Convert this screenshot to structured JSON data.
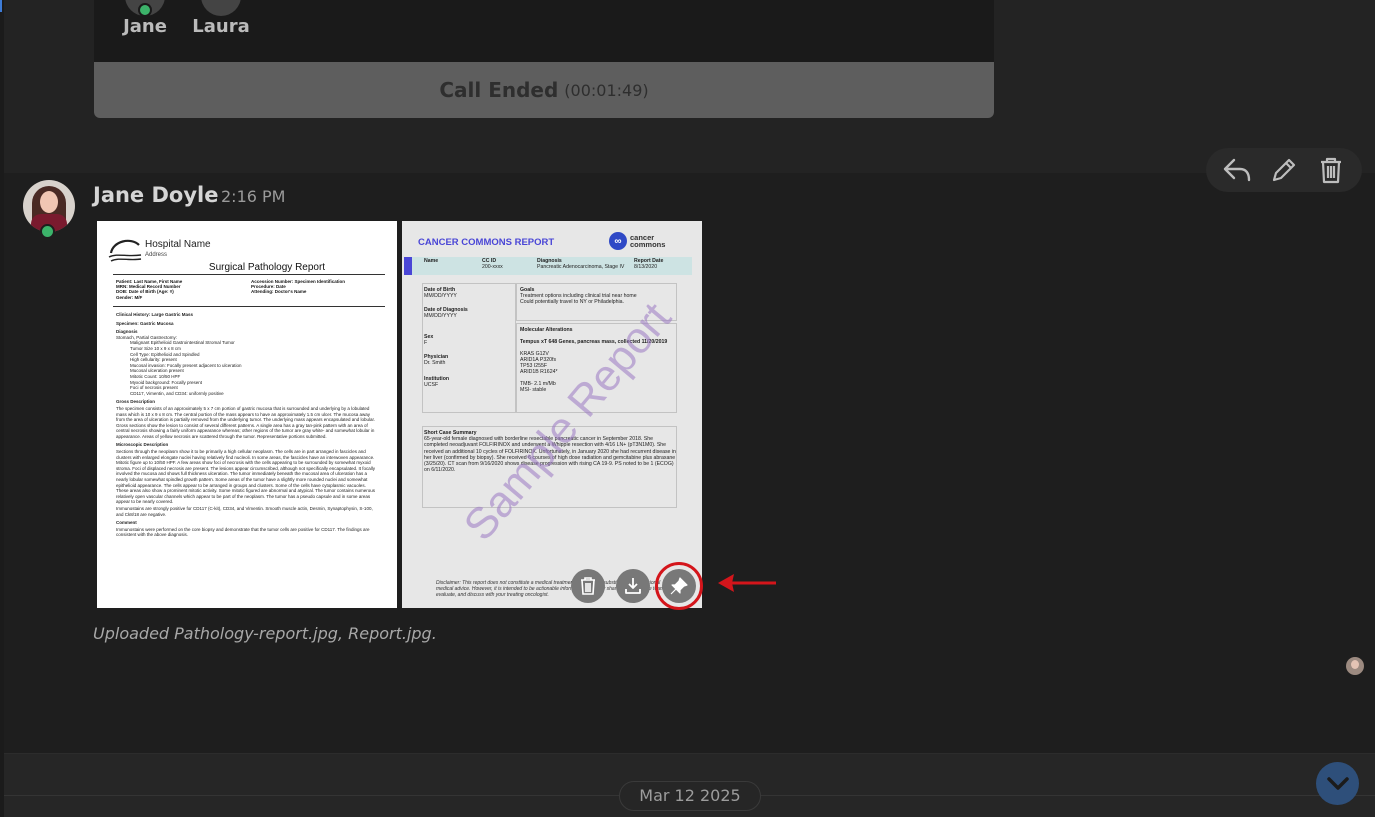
{
  "call": {
    "participants": [
      {
        "name": "Jane"
      },
      {
        "name": "Laura"
      }
    ],
    "ended_label": "Call Ended",
    "duration": "(00:01:49)"
  },
  "message": {
    "sender": "Jane Doyle",
    "time": "2:16 PM",
    "caption": "Uploaded Pathology-report.jpg, Report.jpg.",
    "actions": [
      "reply-icon",
      "edit-icon",
      "delete-icon"
    ]
  },
  "pathology_report": {
    "hospital_name": "Hospital Name",
    "address": "Address",
    "title": "Surgical Pathology Report",
    "meta_left": [
      "Patient: Last Name, First Name",
      "MRN: Medical Record Number",
      "DOB: Date of Birth (Age: #)",
      "Gender: M/F"
    ],
    "meta_right": [
      "Accession Number: Specimen Identification",
      "Procedure: Date",
      "Attending: Doctor's Name"
    ],
    "clinical_history": "Clinical History: Large Gastric Mass",
    "specimen": "Specimen: Gastric Mucosa",
    "diagnosis_heading": "Diagnosis",
    "diagnosis_sub": "Stomach, Partial Gastrectomy:",
    "diagnosis_items": [
      "Malignant Epithelioid Gastrointestinal Stromal Tumor",
      "Tumor Size 10 x 9 x 8 cm",
      "Cell Type: Epithelioid and Spindled",
      "High cellularity: present",
      "Mucosal invasion: Focally present adjacent to ulceration",
      "Mucosal ulceration present",
      "Mitotic Count: 10/50 HPF",
      "Myxoid background: Focally present",
      "Foci of necrosis present",
      "CD117, Vimentin, and CD34: uniformly positive"
    ],
    "gross_heading": "Gross Description",
    "gross_text": "The specimen consists of an approximately 5 x 7 cm portion of gastric mucosa that is surrounded and underlying by a lobulated mass which is 10 x 9 x 8 cm. The central portion of the mass appears to have an approximately 1.5 cm ulcer. The mucosa away from the area of ulceration is partially removed from the underlying tumor. The underlying mass appears encapsulated and lobular. Gross sections show the lesion to consist of several different patterns. A single area has a gray tan-pink pattern with an area of central necrosis showing a fairly uniform appearance whereas; other regions of the tumor are gray white- and somewhat lobular in appearance. Areas of yellow necrosis are scattered through the tumor. Representative portions submitted.",
    "micro_heading": "Microscopic Description",
    "micro_text": "Sections through the neoplasm show it to be primarily a high cellular neoplasm. The cells are in part arranged in fascicles and clusters with enlarged elongate nuclei having relatively find nucleoli. In some areas, the fascicles have an interwoven appearance. Mitotic figure up to 10/50 HPF. A few areas show foci of necrosis with the cells appearing to be surrounded by somewhat myxoid stroma. Foci of displaced necrosis are present. The lesions appear circumscribed, although not specifically encapsulated. It focally involved the mucosa and shows full thickness ulceration. The tumor immediately beneath the mucosal area of ulceration has a nearly lobular somewhat spindled growth pattern. Some areas of the tumor have a slightly more rounded nuclei and somewhat epithelioid appearance. The cells appear to be arranged in groups and clusters. Some of the cells have cytoplasmic vacuoles. These areas also show a prominent mitotic activity. Some mitotic figured are abnormal and atypical. The tumor contains numerous relatively open vascular channels which appear to be part of the neoplasm. The tumor has a pseudo capsule and in some areas appear to be nearly covered.",
    "immuno_text": "Immunostains are strongly positive for CD117 (C-kit), CD34, and Vimentin. Smooth muscle actin, Desmin, Synaptophysin, S-100, and Ck8/18 are negative.",
    "comment_heading": "Comment",
    "comment_text": "Immunostains were performed on the core biopsy and demonstrate that the tumor cells are positive for CD117. The findings are consistent with the above diagnosis."
  },
  "cc_report": {
    "title": "CANCER COMMONS REPORT",
    "logo_line1": "cancer",
    "logo_line2": "commons",
    "band": [
      {
        "label": "Name",
        "value": ""
      },
      {
        "label": "CC ID",
        "value": "200-xxxx"
      },
      {
        "label": "Diagnosis",
        "value": "Pancreatic Adenocarcinoma, Stage IV"
      },
      {
        "label": "Report Date",
        "value": "8/13/2020"
      }
    ],
    "dob_label": "Date of Birth",
    "dob_value": "MM/DD/YYYY",
    "dod_label": "Date of Diagnosis",
    "dod_value": "MM/DD/YYYY",
    "sex_label": "Sex",
    "sex_value": "F",
    "physician_label": "Physician",
    "physician_value": "Dr. Smith",
    "institution_label": "Institution",
    "institution_value": "UCSF",
    "goals_label": "Goals",
    "goals_1": "Treatment options including clinical trial near home",
    "goals_2": "Could potentially travel to NY or Philadelphia.",
    "molecular_label": "Molecular Alterations",
    "molecular_test": "Tempus xT 648 Genes, pancreas mass, collected 11/20/2019",
    "molecular_items": [
      "KRAS G12V",
      "ARID1A P320fs",
      "TP53 I255F",
      "ARID1B R1624*",
      "",
      "TMB- 2.1 m/Mb",
      "MSI- stable"
    ],
    "summary_label": "Short Case Summary",
    "summary_text": "65-year-old female diagnosed with borderline resectable pancreatic cancer in September 2018. She completed neoadjuvant FOLFIRINOX and underwent a Whipple resection with 4/16 LN+ (pT3N1M0). She received an additional 10 cycles of FOLFIRINOX. Unfortunately, in January 2020 she had recurrent disease in her liver (confirmed by biopsy). She received 6 courses of high dose radiation and gemcitabine plus abraxane (3/25/20). CT scan from 9/16/2020 shows disease progression with rising CA 19-9. PS noted to be 1 (ECOG) on 6/11/2020.",
    "disclaimer": "Disclaimer: This report does not constitute a medical treatment and is not a substitute for professional medical advice. However, it is intended to be actionable information you may share with your care team to evaluate, and discuss with your treating oncologist.",
    "watermark": "Sample Report"
  },
  "image_tools": [
    "delete-icon",
    "download-icon",
    "pin-icon"
  ],
  "colors": {
    "highlight_ring": "#d4151b",
    "status_online": "#3cb36a",
    "cc_accent": "#4a46d6"
  },
  "divider": {
    "date": "Mar 12 2025"
  }
}
